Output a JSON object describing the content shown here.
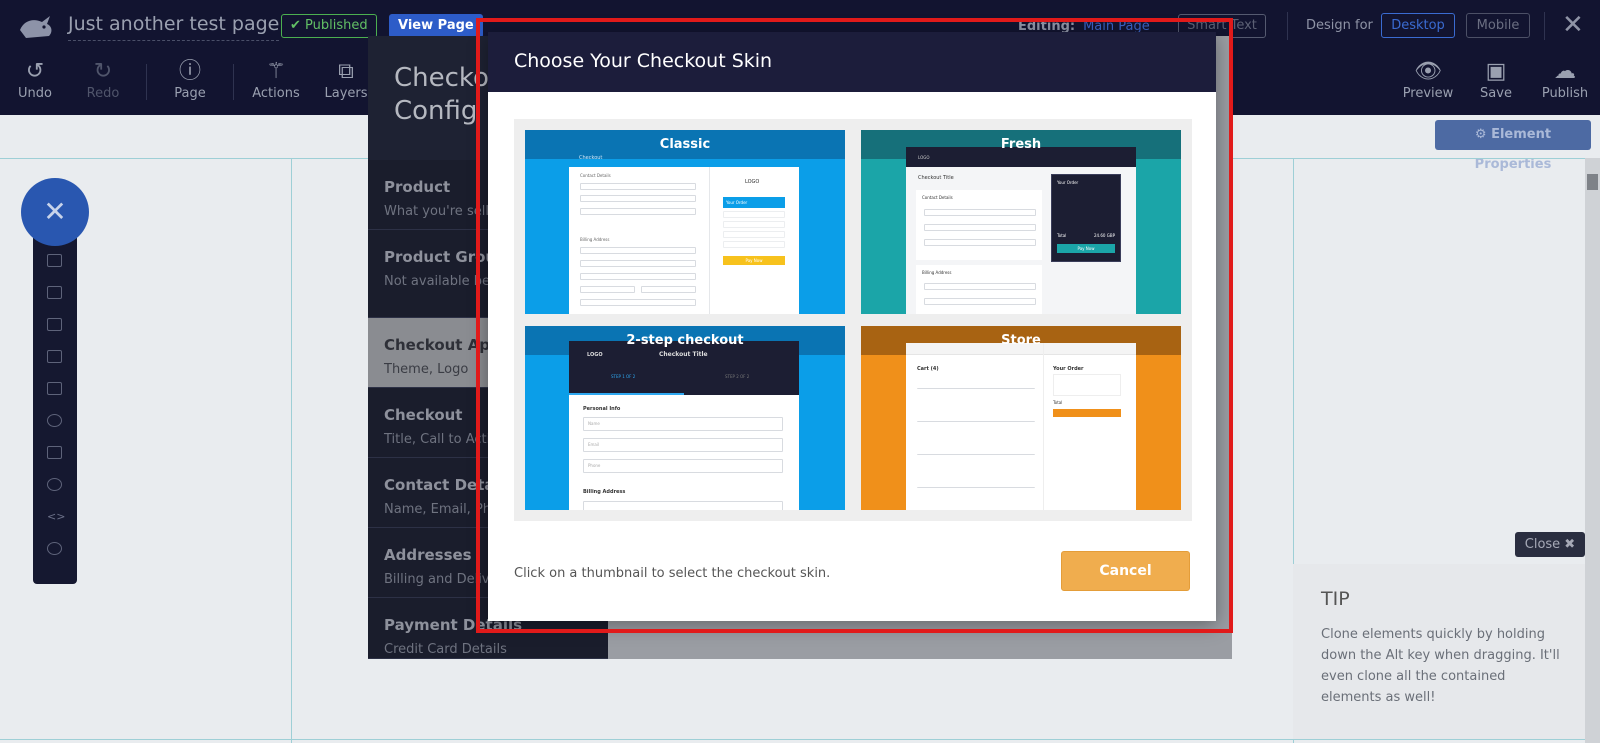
{
  "header": {
    "page_title": "Just another test page",
    "status_badge": "✔ Published",
    "view_page_label": "View Page",
    "editing_label": "Editing:",
    "editing_value": "Main Page",
    "smart_text_label": "Smart Text",
    "design_for_label": "Design for",
    "desktop_label": "Desktop",
    "mobile_label": "Mobile",
    "close_glyph": "✕"
  },
  "toolbar": {
    "undo": "Undo",
    "redo": "Redo",
    "page": "Page",
    "actions": "Actions",
    "layers": "Layers",
    "preview": "Preview",
    "save": "Save",
    "publish": "Publish",
    "element_properties": "⚙ Element Properties"
  },
  "side_panel": {
    "close_label": "Close ✖",
    "tip_title": "TIP",
    "tip_text": "Clone elements quickly by holding down the Alt key when dragging. It'll even clone all the contained elements as well!"
  },
  "config_panel": {
    "title": "Checkout\nConfig",
    "items": [
      {
        "title": "Product",
        "subtitle": "What you're selling"
      },
      {
        "title": "Product Group",
        "subtitle": "Not available bec"
      },
      {
        "title": "Checkout Appearance",
        "subtitle": "Theme, Logo"
      },
      {
        "title": "Checkout",
        "subtitle": "Title, Call to Action"
      },
      {
        "title": "Contact Details",
        "subtitle": "Name, Email, Phone"
      },
      {
        "title": "Addresses",
        "subtitle": "Billing and Delivery"
      },
      {
        "title": "Payment Details",
        "subtitle": "Credit Card Details"
      }
    ]
  },
  "modal": {
    "title": "Choose Your Checkout Skin",
    "skins": [
      {
        "name": "Classic",
        "accent": "#0b9ee8"
      },
      {
        "name": "Fresh",
        "accent": "#1ba5a8"
      },
      {
        "name": "2-step checkout",
        "accent": "#0b9ee8"
      },
      {
        "name": "Store",
        "accent": "#f0901a"
      }
    ],
    "footer_text": "Click on a thumbnail to select the checkout skin.",
    "cancel_label": "Cancel"
  },
  "skin_mock": {
    "classic_heading": "Checkout",
    "classic_contact": "Contact Details",
    "classic_billing": "Billing Address",
    "classic_logo": "LOGO",
    "classic_order": "Your Order",
    "classic_pay": "Pay Now",
    "fresh_logo": "LOGO",
    "fresh_title": "Checkout Title",
    "fresh_contact": "Contact Details",
    "fresh_billing": "Billing Address",
    "fresh_order": "Your Order",
    "fresh_total": "Total",
    "fresh_total_value": "24.60 GBP",
    "fresh_pay": "Pay Now",
    "twostep_logo": "LOGO",
    "twostep_title": "Checkout Title",
    "twostep_step1": "STEP 1 OF 2",
    "twostep_step2": "STEP 2 OF 2",
    "twostep_personal": "Personal Info",
    "twostep_name": "Name",
    "twostep_email": "Email",
    "twostep_phone": "Phone",
    "twostep_billing": "Billing Address",
    "store_cart": "Cart (4)",
    "store_order": "Your Order",
    "store_total": "Total"
  },
  "colors": {
    "topbar": "#121430",
    "modal_header": "#1c1d3b",
    "cancel_button": "#f0ad4e",
    "highlight_box": "#e11a1a",
    "published_green": "#4caf50",
    "accent_blue": "#2d5cc8"
  }
}
